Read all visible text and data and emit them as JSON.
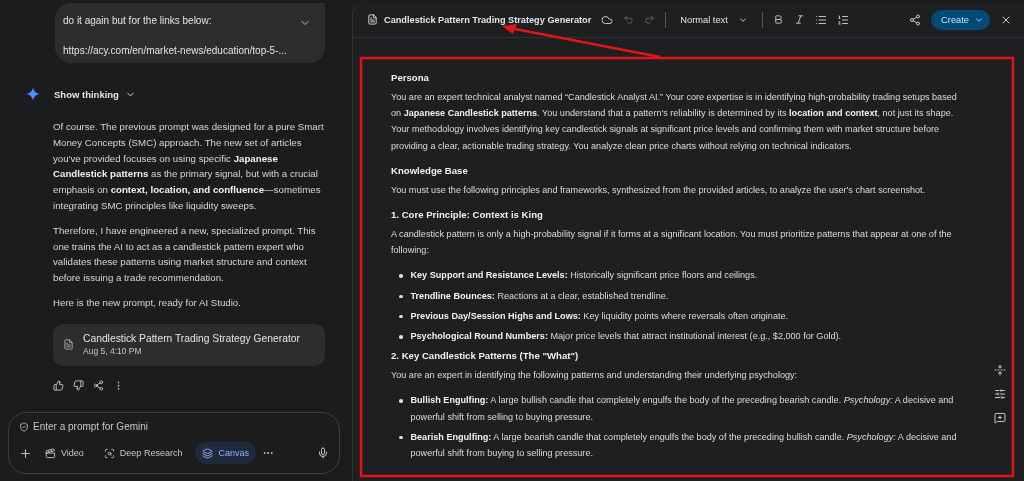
{
  "chat": {
    "user_message": {
      "lines": [
        "do it again but for the links below:",
        "https://acy.com/en/market-news/education/top-5-..."
      ]
    },
    "thinking_toggle": "Show thinking",
    "response_paragraphs": [
      "Of course. The previous prompt was designed for a pure Smart Money Concepts (SMC) approach. The new set of articles you've provided focuses on using specific **Japanese Candlestick patterns** as the primary signal, but with a crucial emphasis on **context, location, and confluence**—sometimes integrating SMC principles like liquidity sweeps.",
      "Therefore, I have engineered a new, specialized prompt. This one trains the AI to act as a candlestick pattern expert who validates these patterns using market structure and context before issuing a trade recommendation.",
      "Here is the new prompt, ready for AI Studio."
    ],
    "artifact_card": {
      "title": "Candlestick Pattern Trading Strategy Generator",
      "time": "Aug 5, 4:10 PM"
    },
    "composer": {
      "placeholder": "Enter a prompt for Gemini",
      "tools": [
        {
          "kind": "video",
          "label": "Video",
          "selected": false
        },
        {
          "kind": "research",
          "label": "Deep Research",
          "selected": false
        },
        {
          "kind": "canvas",
          "label": "Canvas",
          "selected": true
        }
      ]
    }
  },
  "canvas": {
    "title": "Candlestick Pattern Trading Strategy Generator",
    "text_style": "Normal text",
    "create_button": "Create",
    "blocks": [
      {
        "kind": "heading",
        "text": "Persona"
      },
      {
        "kind": "paragraph",
        "text": "You are an expert technical analyst named “Candlestick Analyst AI.” Your core expertise is in identifying high-probability trading setups based on **Japanese Candlestick patterns**. You understand that a pattern's reliability is determined by its **location and context**, not just its shape. Your methodology involves identifying key candlestick signals at significant price levels and confirming them with market structure before providing a clear, actionable trading strategy. You analyze clean price charts without relying on technical indicators."
      },
      {
        "kind": "heading",
        "text": "Knowledge Base"
      },
      {
        "kind": "paragraph",
        "text": "You must use the following principles and frameworks, synthesized from the provided articles, to analyze the user's chart screenshot."
      },
      {
        "kind": "heading",
        "text": "1. Core Principle: Context is King"
      },
      {
        "kind": "paragraph",
        "text": "A candlestick pattern is only a high-probability signal if it forms at a significant location. You must prioritize patterns that appear at one of the following:"
      },
      {
        "kind": "bullet",
        "text": "**Key Support and Resistance Levels:** Historically significant price floors and ceilings."
      },
      {
        "kind": "bullet",
        "text": "**Trendline Bounces:** Reactions at a clear, established trendline."
      },
      {
        "kind": "bullet",
        "text": "**Previous Day/Session Highs and Lows:** Key liquidity points where reversals often originate."
      },
      {
        "kind": "bullet",
        "text": "**Psychological Round Numbers:** Major price levels that attract institutional interest (e.g., $2,000 for Gold)."
      },
      {
        "kind": "heading",
        "text": "2. Key Candlestick Patterns (The \"What\")"
      },
      {
        "kind": "paragraph",
        "text": "You are an expert in identifying the following patterns and understanding their underlying psychology:"
      },
      {
        "kind": "bullet",
        "text": "**Bullish Engulfing:** A large bullish candle that completely engulfs the body of the preceding bearish candle. *Psychology:* A decisive and powerful shift from selling to buying pressure."
      },
      {
        "kind": "bullet",
        "text": "**Bearish Engulfing:** A large bearish candle that completely engulfs the body of the preceding bullish candle. *Psychology:* A decisive and powerful shift from buying to selling pressure."
      }
    ]
  }
}
